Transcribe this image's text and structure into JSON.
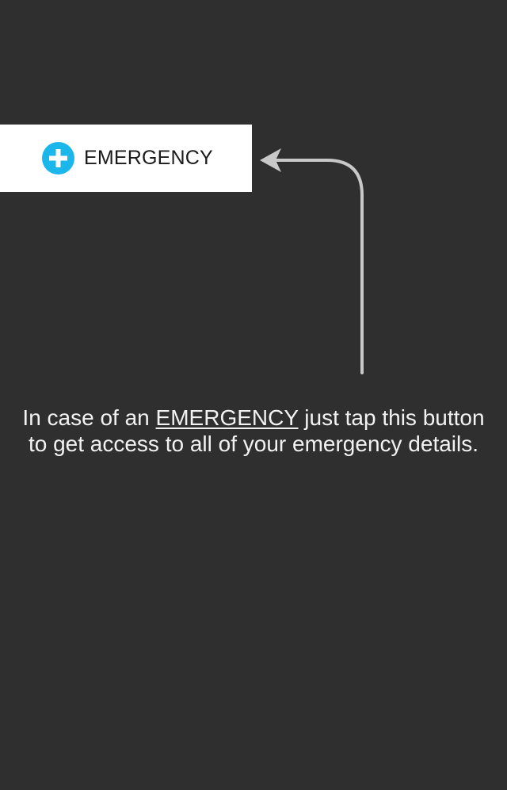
{
  "button": {
    "label": "EMERGENCY",
    "icon": "plus-circle-icon",
    "icon_color": "#1bb7ea",
    "background": "#ffffff"
  },
  "hint": {
    "before": "In case of an",
    "keyword": "EMERGENCY",
    "after": "just tap this button to get access to all of your emergency details."
  },
  "colors": {
    "background": "#2f2f2f",
    "text": "#f2f2f2",
    "arrow": "#c8c8c8"
  }
}
